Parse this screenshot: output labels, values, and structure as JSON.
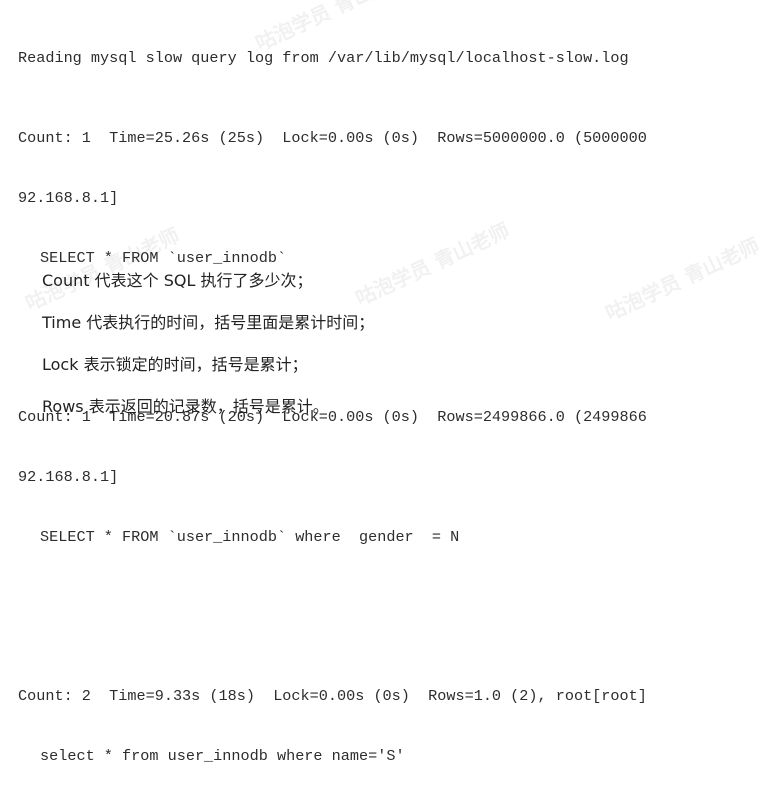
{
  "log": {
    "header": "Reading mysql slow query log from /var/lib/mysql/localhost-slow.log",
    "entries": [
      {
        "stats": "Count: 1  Time=25.26s (25s)  Lock=0.00s (0s)  Rows=5000000.0 (5000000",
        "wrap": "92.168.8.1]",
        "query": "SELECT * FROM `user_innodb`"
      },
      {
        "stats": "Count: 1  Time=20.87s (20s)  Lock=0.00s (0s)  Rows=2499866.0 (2499866",
        "wrap": "92.168.8.1]",
        "query": "SELECT * FROM `user_innodb` where  gender  = N"
      },
      {
        "stats": "Count: 2  Time=9.33s (18s)  Lock=0.00s (0s)  Rows=1.0 (2), root[root]",
        "query": "select * from user_innodb where name='S'"
      }
    ]
  },
  "notes": [
    "Count 代表这个 SQL 执行了多少次；",
    "Time 代表执行的时间，括号里面是累计时间；",
    "Lock 表示锁定的时间，括号是累计；",
    "Rows 表示返回的记录数，括号是累计。"
  ],
  "watermark": "咕泡学员 青山老师"
}
